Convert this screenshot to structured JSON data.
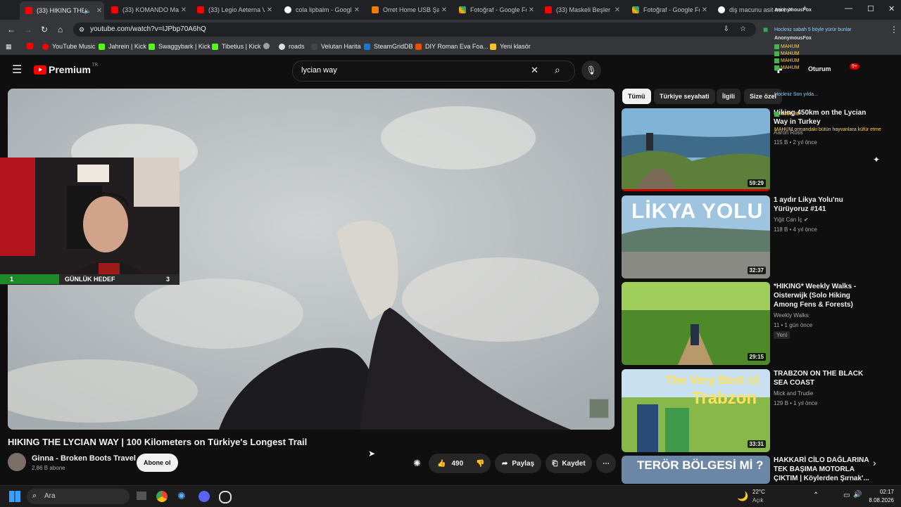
{
  "browser": {
    "tabs": [
      {
        "label": "(33) HIKING THE",
        "active": true,
        "icon": "youtube-icon"
      },
      {
        "label": "(33) KOMANDO Mar",
        "active": false,
        "icon": "youtube-icon"
      },
      {
        "label": "(33) Legio Aeterna V",
        "active": false,
        "icon": "youtube-icon"
      },
      {
        "label": "cola lipbalm - Google",
        "active": false,
        "icon": "google-icon"
      },
      {
        "label": "Orret Home USB Şarj",
        "active": false,
        "icon": "shop-icon"
      },
      {
        "label": "Fotoğraf - Google Fo",
        "active": false,
        "icon": "photos-icon"
      },
      {
        "label": "(33) Maskeli Beşler F",
        "active": false,
        "icon": "youtube-icon"
      },
      {
        "label": "Fotoğraf - Google Fo",
        "active": false,
        "icon": "photos-icon"
      },
      {
        "label": "diş macunu asit mi b",
        "active": false,
        "icon": "google-icon"
      }
    ],
    "url": "youtube.com/watch?v=IJPbp70A6hQ",
    "bookmarks": [
      "YouTube Music",
      "Jahrein | Kick",
      "Swaggybark | Kick",
      "Tibetius | Kick",
      "roads",
      "Velutan Harita",
      "SteamGridDB",
      "DIY Roman Eva Foa...",
      "Yeni klasör"
    ]
  },
  "youtube": {
    "logo_text": "Premium",
    "logo_region": "TR",
    "search_query": "lycian way",
    "signin_partial": "Oturum",
    "notif_count": "9+",
    "video_title": "HIKING THE LYCIAN WAY | 100 Kilometers on Türkiye's Longest Trail",
    "channel_name": "Ginna - Broken Boots Travel",
    "subscribers": "2,86 B abone",
    "subscribe_label": "Abone ol",
    "like_count": "490",
    "share_label": "Paylaş",
    "save_label": "Kaydet",
    "chips": [
      "Tümü",
      "Türkiye seyahati",
      "İlgili",
      "Size özel"
    ],
    "recommendations": [
      {
        "title": "Hiking 450km on the Lycian Way in Turkey",
        "channel": "Aaron Ross",
        "meta": "115 B • 2 yıl önce",
        "duration": "59:29",
        "badge": ""
      },
      {
        "title": "1 aydır Likya Yolu'nu Yürüyoruz #141",
        "channel": "Yiğit Can İç",
        "meta": "118 B • 4 yıl önce",
        "duration": "32:37",
        "badge": "",
        "thumb_text": "LİKYA YOLU"
      },
      {
        "title": "*HIKING* Weekly Walks - Oisterwijk (Solo Hiking Among Fens & Forests)",
        "channel": "Weekly Walks",
        "meta": "11 • 1 gün önce",
        "duration": "29:15",
        "badge": "Yeni"
      },
      {
        "title": "TRABZON ON THE BLACK SEA COAST",
        "channel": "Mick and Trudie",
        "meta": "129 B • 1 yıl önce",
        "duration": "33:31",
        "badge": "",
        "thumb_text1": "The Very Best of",
        "thumb_text2": "Trabzon"
      },
      {
        "title": "HAKKARİ CİLO DAĞLARINA TEK BAŞIMA MOTORLA ÇIKTIM | Köylerden Şırnak'...",
        "channel": "",
        "meta": "",
        "duration": "",
        "badge": "",
        "thumb_text": "TERÖR BÖLGESİ Mİ ?"
      }
    ]
  },
  "overlay": {
    "goal_left": "1",
    "goal_label": "GÜNLÜK HEDEF",
    "goal_right": "3",
    "chat": [
      "AnonymousFox",
      "Hockniz sabah 5 böyle yürür bunlar",
      "AnonymousFox",
      "MAHUM",
      "MAHUM",
      "MAHUM",
      "MAHUM",
      "Hockniz Son yılda...",
      "MAHUM",
      "MAHUM ormandaki bütün hayvanlara küfür etme"
    ]
  },
  "taskbar": {
    "search_placeholder": "Ara",
    "weather_temp": "22°C",
    "weather_text": "Açık",
    "time": "02:17",
    "date": "8.08.2026"
  }
}
